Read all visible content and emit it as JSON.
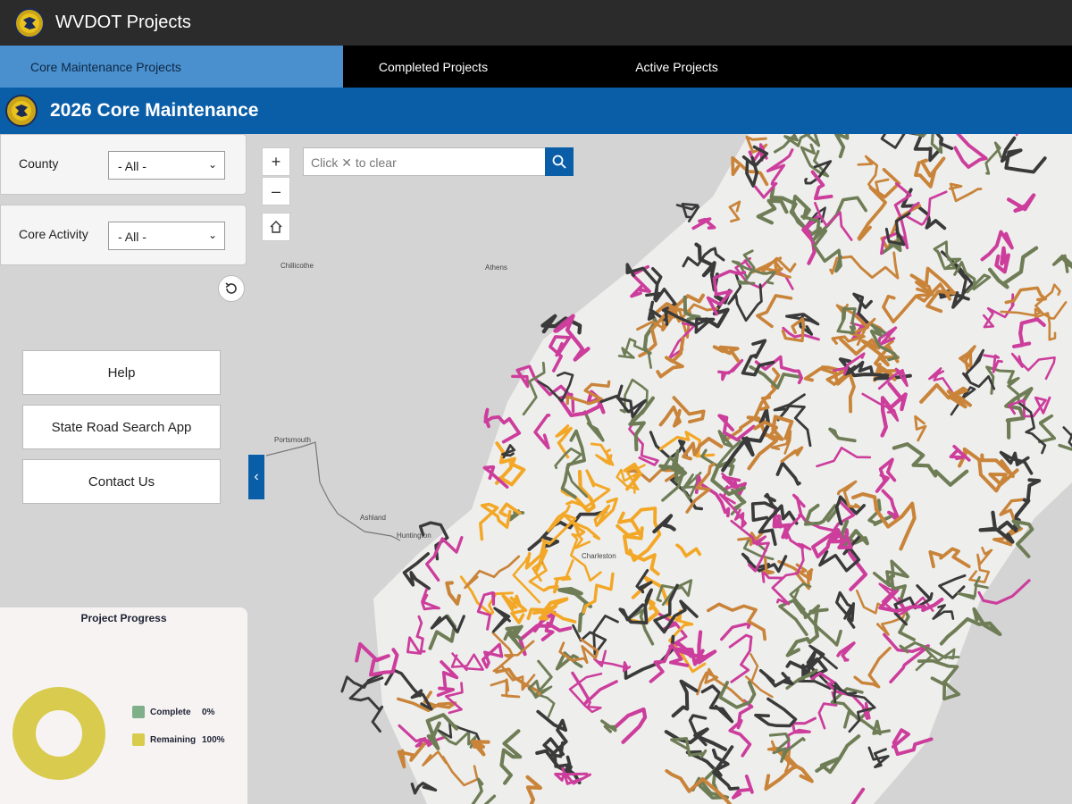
{
  "app": {
    "title": "WVDOT Projects"
  },
  "tabs": [
    {
      "label": "Core Maintenance Projects"
    },
    {
      "label": "Completed Projects"
    },
    {
      "label": "Active Projects"
    }
  ],
  "banner": {
    "title": "2026 Core Maintenance"
  },
  "filters": {
    "county": {
      "label": "County",
      "value": "- All -"
    },
    "activity": {
      "label": "Core Activity",
      "value": "- All -"
    }
  },
  "buttons": {
    "help": "Help",
    "search_app": "State Road Search App",
    "contact": "Contact Us"
  },
  "progress": {
    "title": "Project Progress",
    "items": [
      {
        "label": "Complete",
        "value": "0%",
        "color": "#7fb08a"
      },
      {
        "label": "Remaining",
        "value": "100%",
        "color": "#d8cb4d"
      }
    ]
  },
  "map": {
    "search_placeholder": "Click ✕ to clear",
    "places": [
      "Chillicothe",
      "Athens",
      "Portsmouth",
      "Ashland",
      "Huntington",
      "Charleston"
    ],
    "road_colors": [
      "#cc3d9c",
      "#c9843a",
      "#6f7d56",
      "#3a3a3a",
      "#f3a726"
    ]
  }
}
